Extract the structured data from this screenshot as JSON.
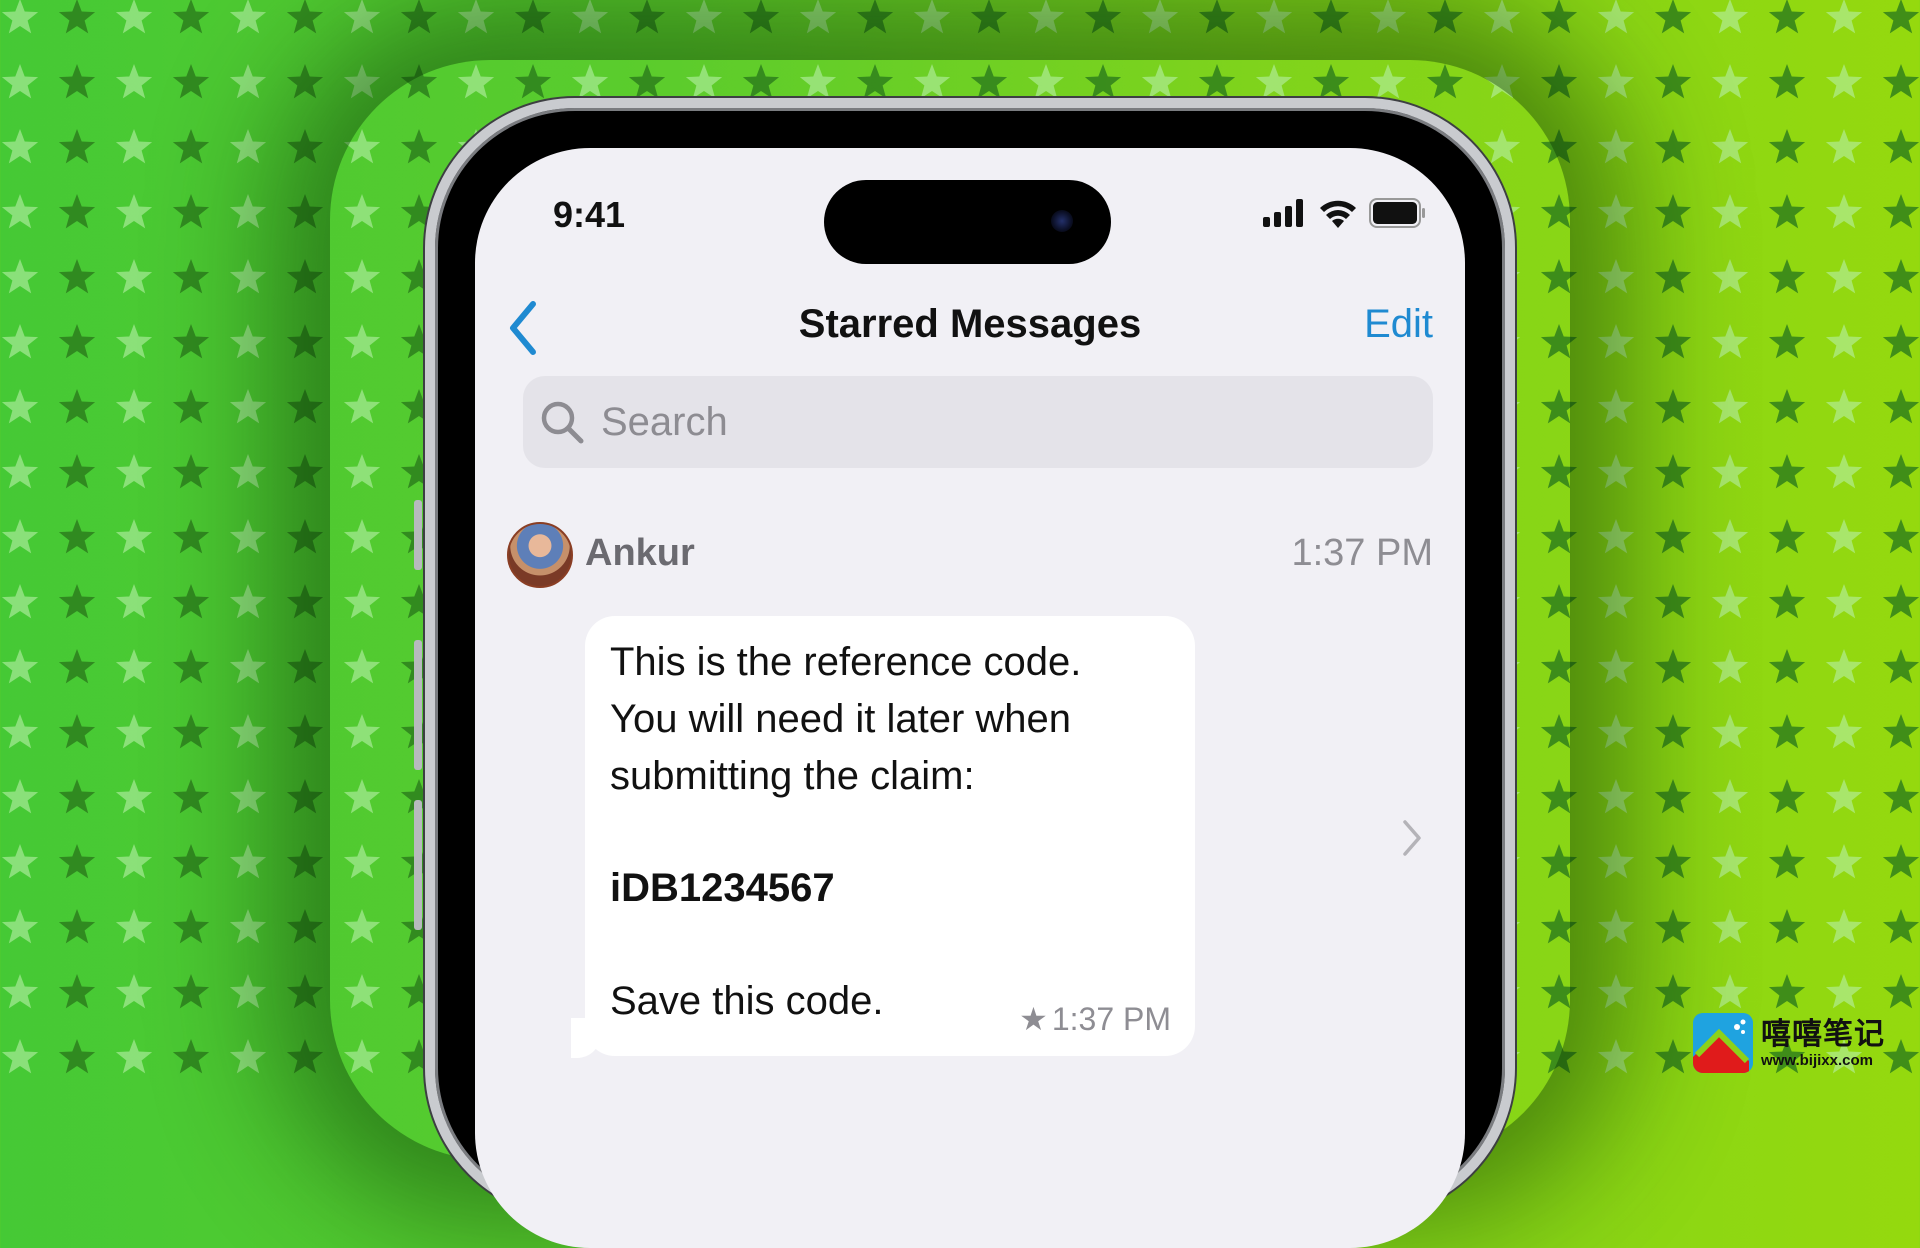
{
  "background": {
    "base_colors": [
      "#45c935",
      "#95d90e"
    ],
    "star_light": "#b8f0a8",
    "star_dark": "#2a7a1c"
  },
  "status_bar": {
    "time": "9:41",
    "icons": [
      "signal-icon",
      "wifi-icon",
      "battery-icon"
    ]
  },
  "nav": {
    "back_icon": "chevron-left-icon",
    "title": "Starred Messages",
    "edit_label": "Edit",
    "accent_color": "#1f8ad1"
  },
  "search": {
    "placeholder": "Search",
    "value": ""
  },
  "messages": [
    {
      "sender": "Ankur",
      "time": "1:37 PM",
      "lines": [
        "This is the reference code.",
        "You will need it later when",
        "submitting the claim:"
      ],
      "code": "iDB1234567",
      "closing": "Save this code.",
      "starred": true,
      "bubble_time": "1:37 PM"
    }
  ],
  "watermark": {
    "title": "嘻嘻笔记",
    "url": "www.bijixx.com"
  }
}
